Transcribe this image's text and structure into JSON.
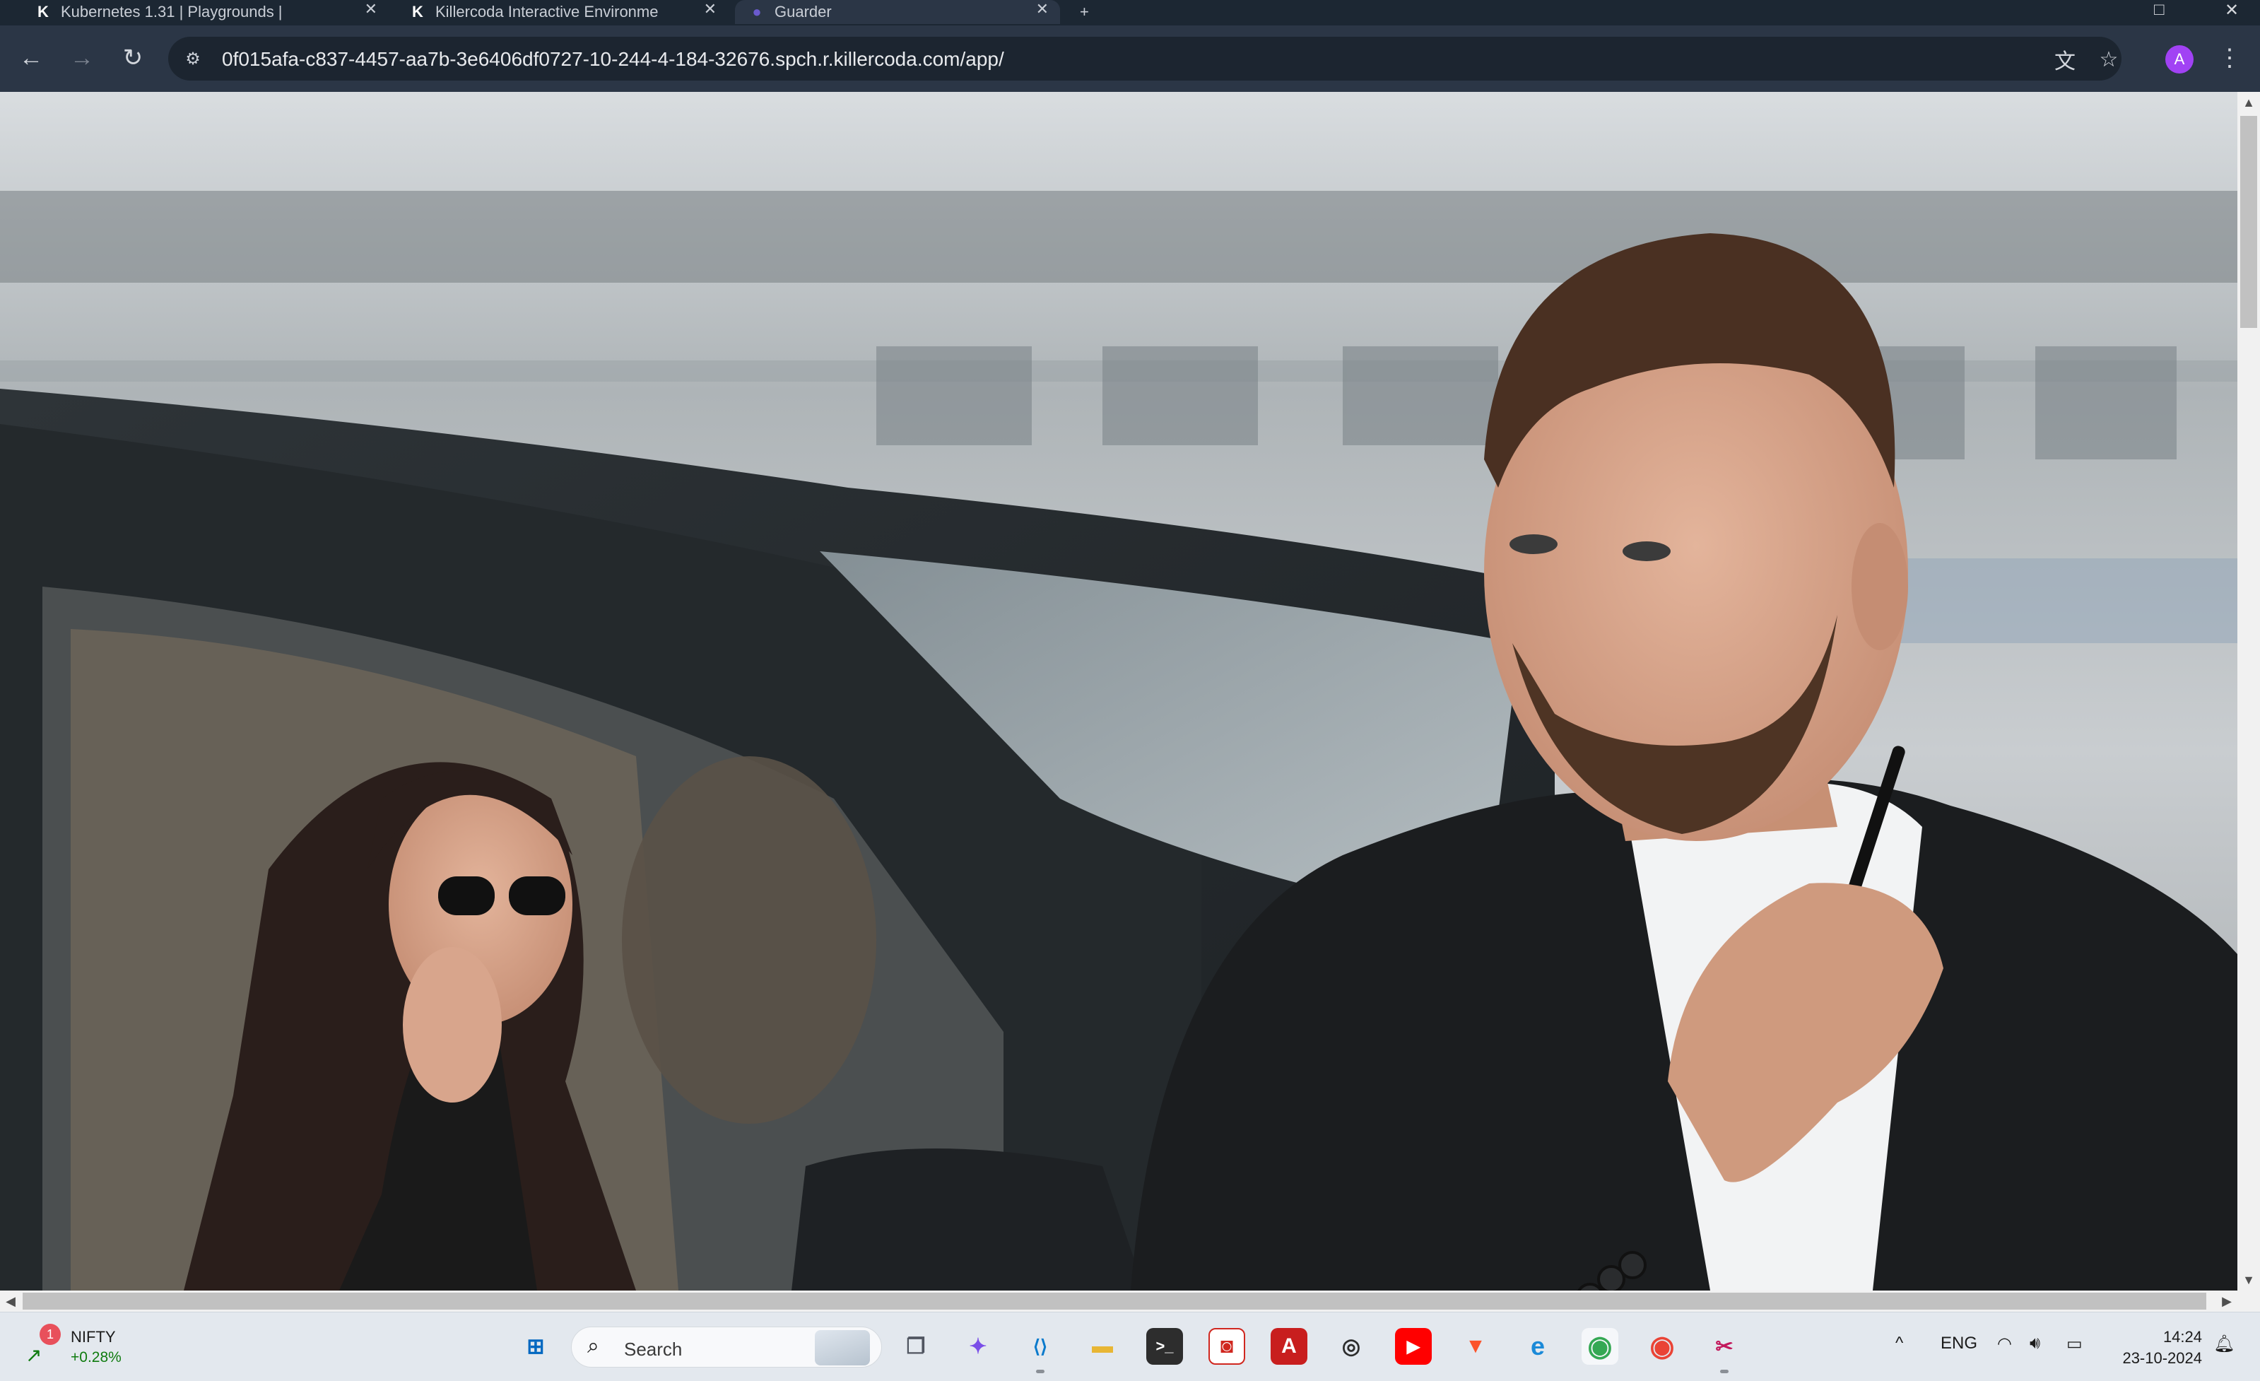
{
  "browser": {
    "tabs": [
      {
        "title": "Kubernetes 1.31 | Playgrounds |",
        "favicon": "K"
      },
      {
        "title": "Killercoda Interactive Environme",
        "favicon": "K"
      },
      {
        "title": "Guarder",
        "favicon": "●"
      }
    ],
    "new_tab": "+",
    "url": "0f015afa-c837-4457-aa7b-3e6406df0727-10-244-4-184-32676.spch.r.killercoda.com/app/",
    "profile_initial": "A",
    "icons": {
      "back": "←",
      "forward": "→",
      "reload": "↻",
      "site_info": "⚙",
      "translate": "文",
      "bookmark": "☆",
      "menu": "⋮",
      "close": "✕",
      "minimize": "–",
      "maximize": "□",
      "window_close": "✕"
    }
  },
  "page": {
    "hero_image_alt": "Bodyguard in black suit with walkie-talkie standing next to a car with a woman on the phone inside"
  },
  "taskbar": {
    "ticker": {
      "name": "NIFTY",
      "change": "+0.28%",
      "badge": "1"
    },
    "search_label": "Search",
    "tray": {
      "language": "ENG",
      "chevron": "^"
    },
    "clock": {
      "time": "14:24",
      "date": "23-10-2024"
    },
    "apps": [
      {
        "name": "start",
        "glyph": "⊞"
      },
      {
        "name": "task-view",
        "glyph": "❐"
      },
      {
        "name": "copilot",
        "glyph": "✦"
      },
      {
        "name": "vscode",
        "glyph": "⟨⟩"
      },
      {
        "name": "file-explorer",
        "glyph": "▬"
      },
      {
        "name": "terminal",
        "glyph": ">_"
      },
      {
        "name": "app-red",
        "glyph": "◙"
      },
      {
        "name": "acrobat",
        "glyph": "A"
      },
      {
        "name": "app-camera",
        "glyph": "◎"
      },
      {
        "name": "youtube",
        "glyph": "▶"
      },
      {
        "name": "brave",
        "glyph": "▼"
      },
      {
        "name": "edge",
        "glyph": "e"
      },
      {
        "name": "chrome-profile",
        "glyph": "◉"
      },
      {
        "name": "chrome",
        "glyph": "◉"
      },
      {
        "name": "snipping-tool",
        "glyph": "✂"
      }
    ]
  }
}
